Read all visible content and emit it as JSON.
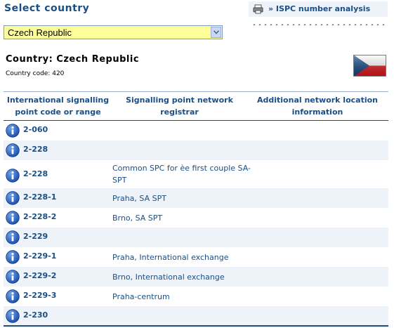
{
  "select_country_title": "Select country",
  "ispc_link": "» ISPC number analysis",
  "country_select": {
    "value": "Czech Republic"
  },
  "country_heading": "Country: Czech Republic",
  "country_code": "Country code: 420",
  "colors": {
    "accent": "#1a4f86",
    "row_shade": "#eef2f9",
    "select_bg": "#ffff99"
  },
  "table": {
    "headers": [
      "International signalling point code or range",
      "Signalling point network registrar",
      "Additional network location information"
    ],
    "rows": [
      {
        "code": "2-060",
        "registrar": "",
        "info": ""
      },
      {
        "code": "2-228",
        "registrar": "",
        "info": ""
      },
      {
        "code": "2-228",
        "registrar": "Common SPC for èe first couple SA-SPT",
        "info": ""
      },
      {
        "code": "2-228-1",
        "registrar": "Praha, SA SPT",
        "info": ""
      },
      {
        "code": "2-228-2",
        "registrar": "Brno, SA SPT",
        "info": ""
      },
      {
        "code": "2-229",
        "registrar": "",
        "info": ""
      },
      {
        "code": "2-229-1",
        "registrar": "Praha, International exchange",
        "info": ""
      },
      {
        "code": "2-229-2",
        "registrar": "Brno, International exchange",
        "info": ""
      },
      {
        "code": "2-229-3",
        "registrar": "Praha-centrum",
        "info": ""
      },
      {
        "code": "2-230",
        "registrar": "",
        "info": ""
      }
    ]
  }
}
